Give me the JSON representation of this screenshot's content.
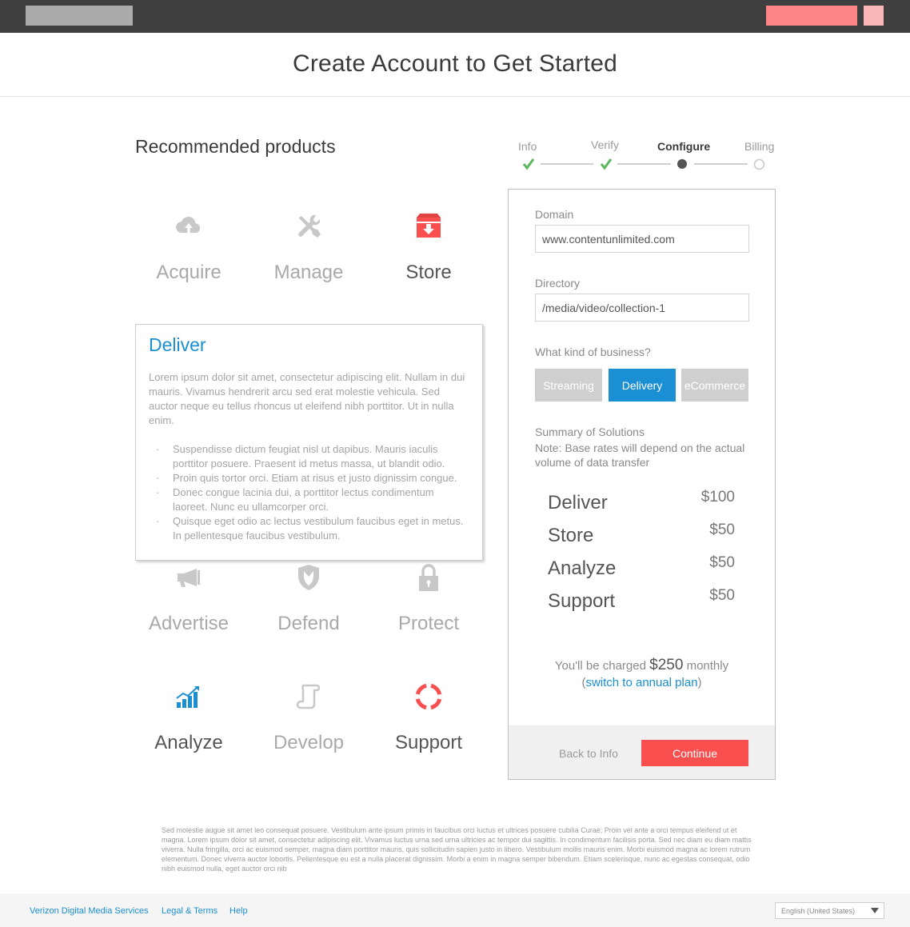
{
  "page": {
    "title": "Create Account to Get Started",
    "section_title": "Recommended products"
  },
  "colors": {
    "topbar": "#3f3f3f",
    "accent_blue": "#1b8fd3",
    "accent_red": "#fa4f4f",
    "check_green": "#5cb85c",
    "muted_icon": "#c8c8c8"
  },
  "products": [
    {
      "label": "Acquire",
      "icon": "cloud-upload-icon",
      "active": false
    },
    {
      "label": "Manage",
      "icon": "tools-icon",
      "active": false
    },
    {
      "label": "Store",
      "icon": "storage-box-icon",
      "active": true
    },
    {
      "label": "Advertise",
      "icon": "megaphone-icon",
      "active": false
    },
    {
      "label": "Defend",
      "icon": "shield-icon",
      "active": false
    },
    {
      "label": "Protect",
      "icon": "lock-icon",
      "active": false
    },
    {
      "label": "Analyze",
      "icon": "bar-chart-icon",
      "active": true
    },
    {
      "label": "Develop",
      "icon": "scroll-icon",
      "active": false
    },
    {
      "label": "Support",
      "icon": "lifebuoy-icon",
      "active": true
    }
  ],
  "deliver_card": {
    "title": "Deliver",
    "body": "Lorem ipsum dolor sit amet, consectetur adipiscing elit. Nullam in dui mauris. Vivamus hendrerit arcu sed erat molestie vehicula. Sed auctor neque eu tellus rhoncus ut eleifend nibh porttitor. Ut in nulla enim.",
    "bullets": [
      "Suspendisse dictum feugiat nisl ut dapibus. Mauris iaculis porttitor posuere. Praesent id metus massa, ut blandit odio.",
      "Proin quis tortor orci. Etiam at risus et justo dignissim congue.",
      "Donec congue lacinia dui, a porttitor lectus condimentum laoreet. Nunc eu ullamcorper orci.",
      "Quisque eget odio ac lectus vestibulum faucibus eget in metus. In pellentesque faucibus vestibulum."
    ]
  },
  "stepper": {
    "steps": [
      {
        "label": "Info",
        "state": "done"
      },
      {
        "label": "Verify",
        "state": "done"
      },
      {
        "label": "Configure",
        "state": "current"
      },
      {
        "label": "Billing",
        "state": "todo"
      }
    ]
  },
  "config": {
    "domain_label": "Domain",
    "domain_value": "www.contentunlimited.com",
    "directory_label": "Directory",
    "directory_value": "/media/video/collection-1",
    "business_label": "What kind of business?",
    "business_options": [
      "Streaming",
      "Delivery",
      "eCommerce"
    ],
    "business_selected": "Delivery",
    "summary_title": "Summary of Solutions",
    "summary_note": "Note: Base rates will depend on the actual volume of data transfer",
    "summary": [
      {
        "name": "Deliver",
        "price": "$100"
      },
      {
        "name": "Store",
        "price": "$50"
      },
      {
        "name": "Analyze",
        "price": "$50"
      },
      {
        "name": "Support",
        "price": "$50"
      }
    ],
    "charge_prefix": "You'll be charged",
    "charge_amount": "$250",
    "charge_suffix": "monthly",
    "annual_open": "(",
    "annual_link": "switch to annual plan",
    "annual_close": ")",
    "back_label": "Back to Info",
    "continue_label": "Continue"
  },
  "fine_print": "Sed molestie augue sit amet leo consequat posuere. Vestibulum ante ipsum primis in faucibus orci luctus et ultrices posuere cubilia Curae; Proin vel ante a orci tempus eleifend ut et magna. Lorem ipsum dolor sit amet, consectetur adipiscing elit. Vivamus luctus urna sed urna ultricies ac tempor dui sagittis. In condimentum facilisis porta. Sed nec diam eu diam mattis viverra. Nulla fringilla, orci ac euismod semper, magna diam porttitor mauris, quis sollicitudin sapien justo in libero. Vestibulum mollis mauris enim. Morbi euismod magna ac lorem rutrum elementum. Donec viverra auctor lobortis. Pellentesque eu est a nulla placerat dignissim. Morbi a enim in magna semper bibendum. Etiam scelerisque, nunc ac egestas consequat, odio nibh euismod nulla, eget auctor orci nib",
  "footer": {
    "links": [
      "Verizon Digital Media Services",
      "Legal & Terms",
      "Help"
    ],
    "language": "English (United States)"
  }
}
